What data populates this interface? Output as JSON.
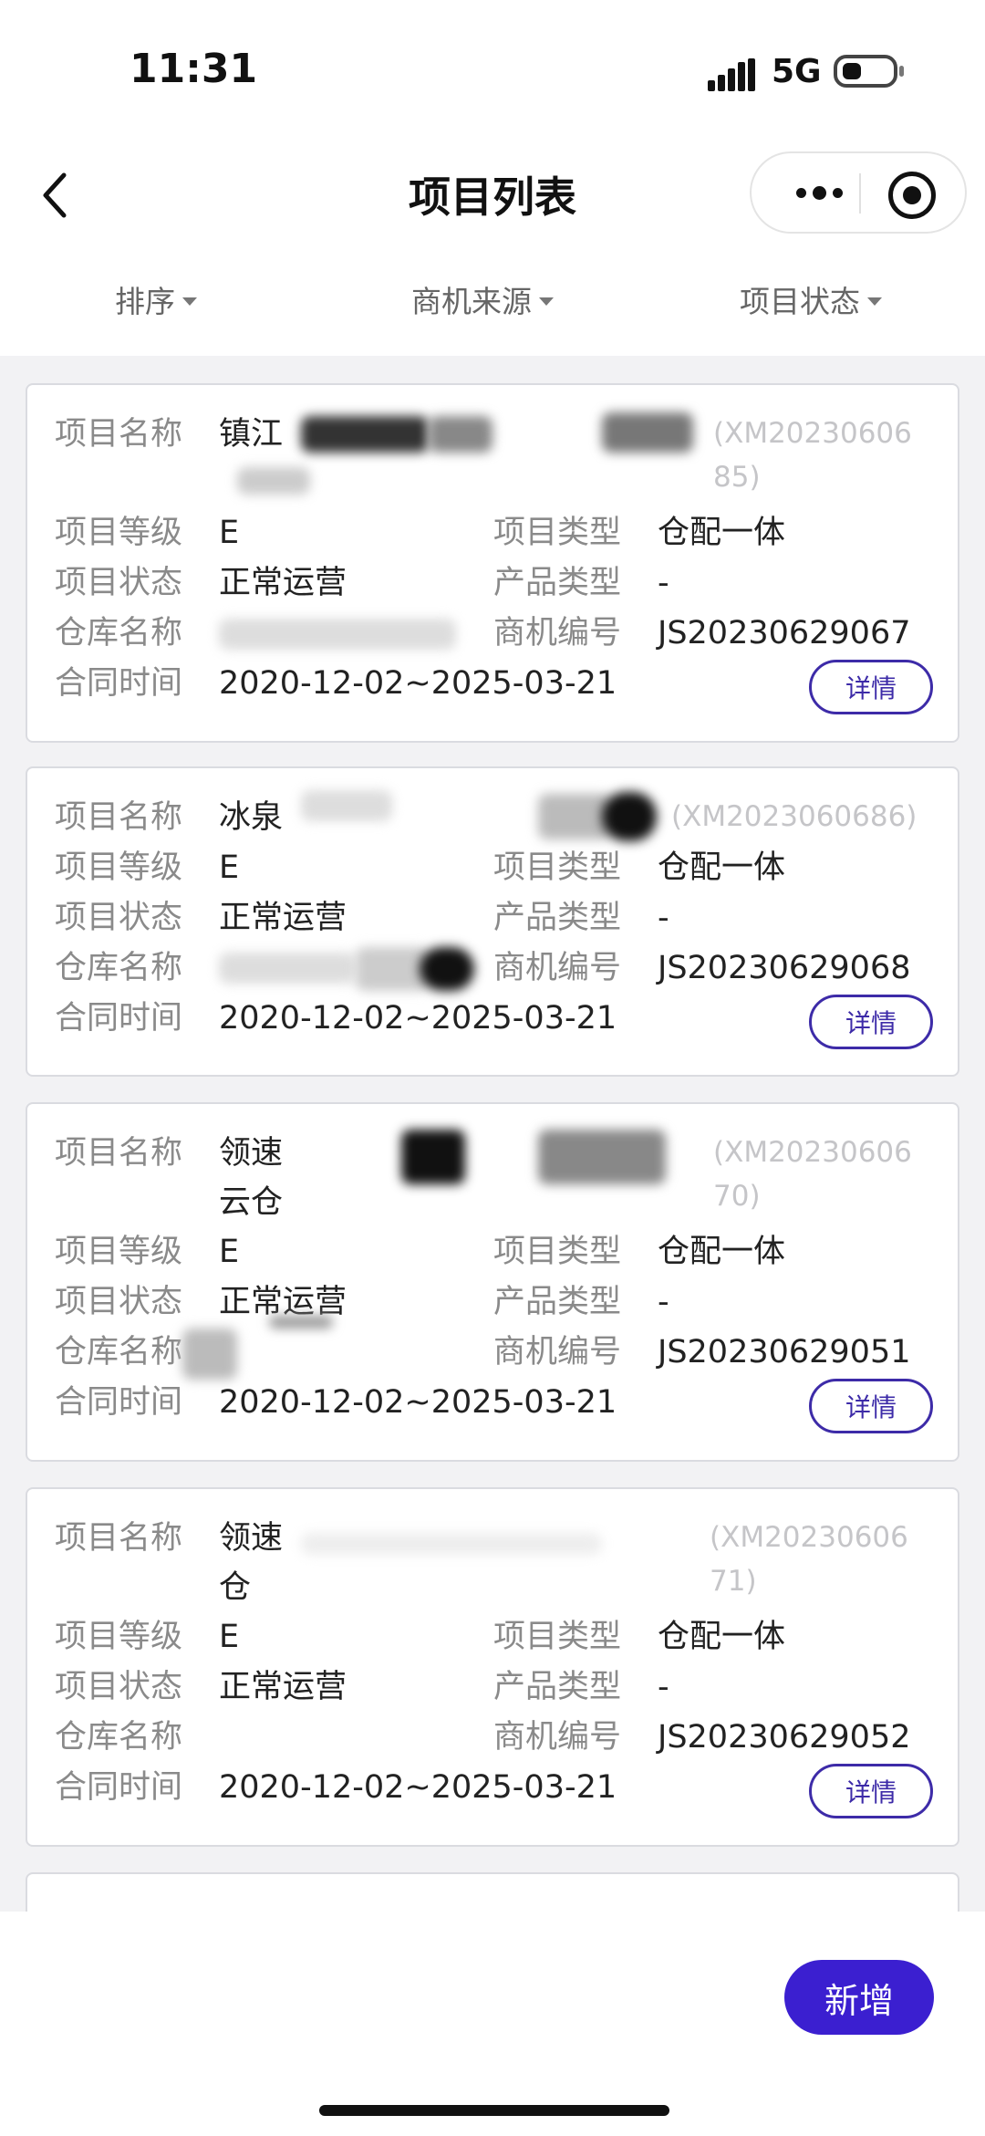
{
  "status_bar": {
    "time": "11:31",
    "network": "5G"
  },
  "nav": {
    "title": "项目列表"
  },
  "filters": [
    {
      "label": "排序"
    },
    {
      "label": "商机来源"
    },
    {
      "label": "项目状态"
    }
  ],
  "labels": {
    "name": "项目名称",
    "level": "项目等级",
    "status": "项目状态",
    "warehouse": "仓库名称",
    "contract": "合同时间",
    "type": "项目类型",
    "product": "产品类型",
    "opp": "商机编号",
    "detail": "详情"
  },
  "projects": [
    {
      "name_visible": "镇江",
      "code_line1": "(XM20230606",
      "code_line2": "85)",
      "level": "E",
      "status": "正常运营",
      "warehouse": "",
      "contract": "2020-12-02~2025-03-21",
      "type": "仓配一体",
      "product": "-",
      "opp": "JS20230629067"
    },
    {
      "name_visible": "冰泉",
      "code_line1": "(XM2023060686)",
      "level": "E",
      "status": "正常运营",
      "warehouse": "",
      "contract": "2020-12-02~2025-03-21",
      "type": "仓配一体",
      "product": "-",
      "opp": "JS20230629068"
    },
    {
      "name_visible": "领速",
      "name_line2": "云仓",
      "code_line1": "(XM20230606",
      "code_line2": "70)",
      "level": "E",
      "status": "正常运营",
      "warehouse": "",
      "contract": "2020-12-02~2025-03-21",
      "type": "仓配一体",
      "product": "-",
      "opp": "JS20230629051"
    },
    {
      "name_visible": "领速",
      "name_line2": "仓",
      "code_line1": "(XM20230606",
      "code_line2": "71)",
      "level": "E",
      "status": "正常运营",
      "warehouse": "",
      "contract": "2020-12-02~2025-03-21",
      "type": "仓配一体",
      "product": "-",
      "opp": "JS20230629052"
    }
  ],
  "actions": {
    "add": "新增"
  },
  "colors": {
    "accent": "#3b1fd0",
    "outline": "#3d2ba8",
    "label": "#8a8a8a"
  }
}
